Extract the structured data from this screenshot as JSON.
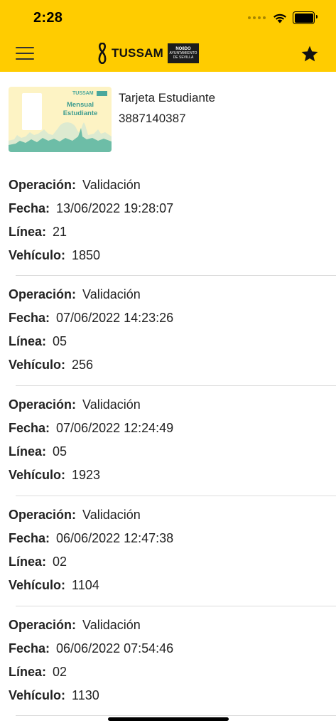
{
  "status_bar": {
    "time": "2:28"
  },
  "header": {
    "menu_icon": "hamburger-icon",
    "logo_text": "TUSSAM",
    "logo_box_line1": "NO8DO",
    "logo_box_line2": "AYUNTAMIENTO",
    "logo_box_line3": "DE SEVILLA",
    "favorite_icon": "star-icon",
    "background_color": "#FFCC00"
  },
  "card": {
    "image_brand": "TUSSAM",
    "image_title_line1": "Mensual",
    "image_title_line2": "Estudiante",
    "name": "Tarjeta Estudiante",
    "number": "3887140387"
  },
  "labels": {
    "operacion": "Operación:",
    "fecha": "Fecha:",
    "linea": "Línea:",
    "vehiculo": "Vehículo:"
  },
  "records": [
    {
      "operacion": "Validación",
      "fecha": "13/06/2022 19:28:07",
      "linea": "21",
      "vehiculo": "1850"
    },
    {
      "operacion": "Validación",
      "fecha": "07/06/2022 14:23:26",
      "linea": "05",
      "vehiculo": "256"
    },
    {
      "operacion": "Validación",
      "fecha": "07/06/2022 12:24:49",
      "linea": "05",
      "vehiculo": "1923"
    },
    {
      "operacion": "Validación",
      "fecha": "06/06/2022 12:47:38",
      "linea": "02",
      "vehiculo": "1104"
    },
    {
      "operacion": "Validación",
      "fecha": "06/06/2022 07:54:46",
      "linea": "02",
      "vehiculo": "1130"
    }
  ]
}
